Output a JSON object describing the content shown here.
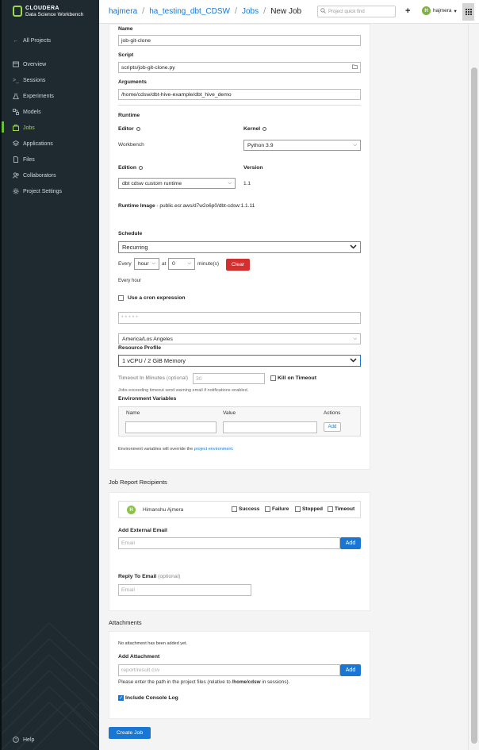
{
  "sidebar": {
    "brand_line1": "CLOUDERA",
    "brand_line2": "Data Science Workbench",
    "back_label": "All Projects",
    "items": [
      {
        "label": "Overview",
        "icon": "overview-icon"
      },
      {
        "label": "Sessions",
        "icon": "terminal-icon"
      },
      {
        "label": "Experiments",
        "icon": "flask-icon"
      },
      {
        "label": "Models",
        "icon": "models-icon"
      },
      {
        "label": "Jobs",
        "icon": "jobs-icon",
        "active": true
      },
      {
        "label": "Applications",
        "icon": "applications-icon"
      },
      {
        "label": "Files",
        "icon": "file-icon"
      },
      {
        "label": "Collaborators",
        "icon": "users-icon"
      },
      {
        "label": "Project Settings",
        "icon": "gear-icon"
      }
    ],
    "help_label": "Help"
  },
  "header": {
    "breadcrumbs": [
      "hajmera",
      "ha_testing_dbt_CDSW",
      "Jobs",
      "New Job"
    ],
    "search_placeholder": "Project quick find",
    "user_initial": "H",
    "user_name": "hajmera"
  },
  "form": {
    "name_label": "Name",
    "name_value": "job-git-clone",
    "script_label": "Script",
    "script_value": "scripts/job-git-clone.py",
    "arguments_label": "Arguments",
    "arguments_value": "/home/cdsw/dbt-hive-example/dbt_hive_demo",
    "runtime_title": "Runtime",
    "editor_label": "Editor",
    "editor_value": "Workbench",
    "kernel_label": "Kernel",
    "kernel_value": "Python 3.9",
    "edition_label": "Edition",
    "edition_value": "dbt cdsw custom runtime",
    "version_label": "Version",
    "version_value": "1.1",
    "runtime_image_label": "Runtime Image",
    "runtime_image_value": "- public.ecr.aws/d7w2o6p0/dbt-cdsw:1.1.11",
    "schedule_label": "Schedule",
    "schedule_value": "Recurring",
    "every_label": "Every",
    "every_value": "hour",
    "at_label": "at",
    "at_value": "0",
    "minutes_label": "minute(s)",
    "clear_label": "Clear",
    "every_hour_text": "Every hour",
    "cron_label": "Use a cron expression",
    "cron_placeholder": "* * * * *",
    "timezone_value": "America/Los Angeles",
    "resource_label": "Resource Profile",
    "resource_value": "1 vCPU / 2 GiB Memory",
    "timeout_label": "Timeout In Minutes",
    "timeout_optional": "(optional)",
    "timeout_placeholder": "30",
    "kill_label": "Kill on Timeout",
    "timeout_note": "Jobs exceeding timeout send warning email if notifications enabled.",
    "env_label": "Environment Variables",
    "env_col_name": "Name",
    "env_col_value": "Value",
    "env_col_actions": "Actions",
    "env_add": "Add",
    "env_note_prefix": "Environment variables will override the",
    "env_note_link": "project environment",
    "env_note_suffix": "."
  },
  "recipients": {
    "title": "Job Report Recipients",
    "user_initial": "H",
    "user_name": "Himanshu Ajmera",
    "success": "Success",
    "failure": "Failure",
    "stopped": "Stopped",
    "timeout": "Timeout",
    "ext_email_label": "Add External Email",
    "ext_email_placeholder": "Email",
    "add_label": "Add",
    "reply_label": "Reply To Email",
    "reply_optional": "(optional)",
    "reply_placeholder": "Email"
  },
  "attachments": {
    "title": "Attachments",
    "none_text": "No attachment has been added yet.",
    "add_label": "Add Attachment",
    "path_placeholder": "report/result.csv",
    "add_button": "Add",
    "note_prefix": "Please enter the path in the project files (relative to",
    "note_path": "/home/cdsw",
    "note_suffix": "in sessions).",
    "console_label": "Include Console Log"
  },
  "footer": {
    "create_label": "Create Job"
  },
  "colors": {
    "sidebar_bg": "#1e2a30",
    "accent_green": "#9ad94a",
    "primary_blue": "#1976d2",
    "danger_red": "#d32f2f"
  }
}
